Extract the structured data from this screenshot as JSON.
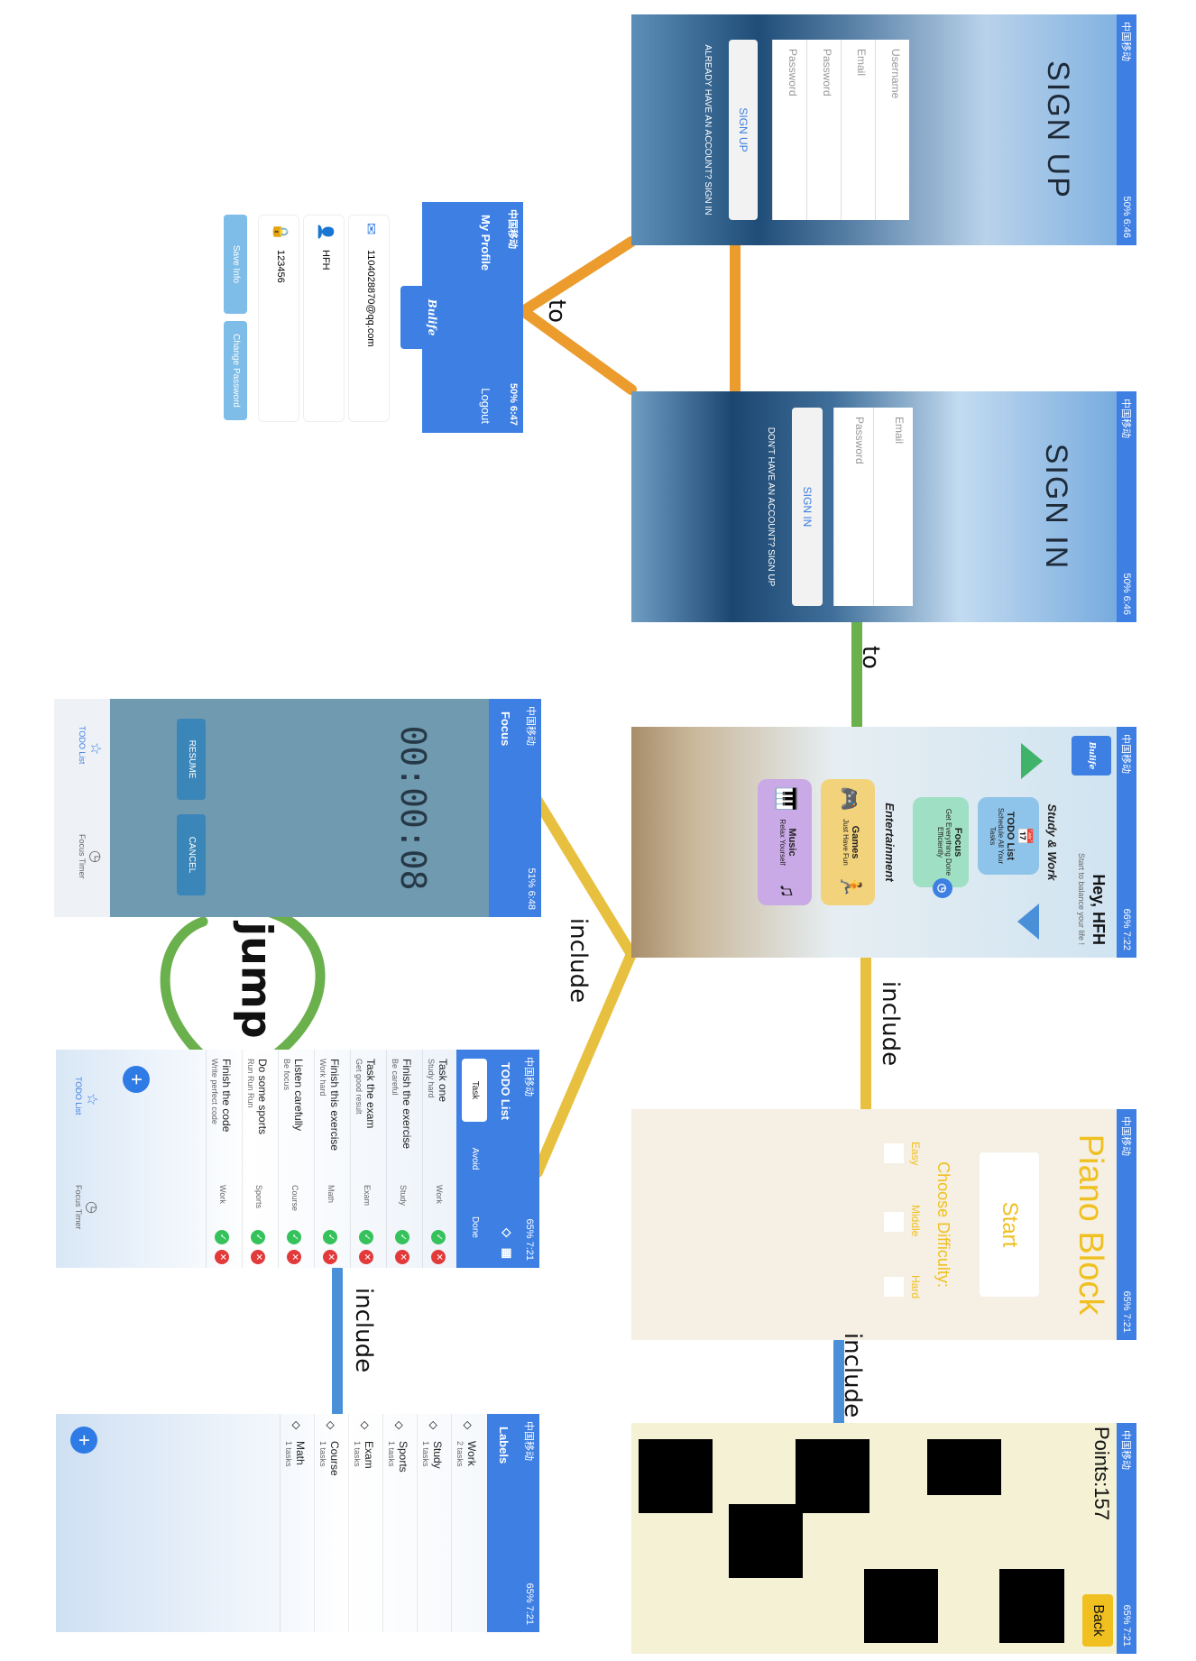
{
  "annotations": {
    "to_1": "to",
    "to_2": "to",
    "include_1": "include",
    "include_2": "include",
    "include_3": "include",
    "include_4": "include",
    "jump": "jump"
  },
  "colors": {
    "orange": "#ec9b2d",
    "green": "#6ab04c",
    "yellow": "#e8c040",
    "blue": "#4a90d9",
    "app_blue": "#3d7fe3"
  },
  "sign_up": {
    "title": "SIGN UP",
    "username": "Username",
    "email": "Email",
    "password": "Password",
    "password2": "Password",
    "button": "SIGN UP",
    "link": "ALREADY HAVE AN ACCOUNT? SIGN IN"
  },
  "sign_in": {
    "title": "SIGN IN",
    "email": "Email",
    "password": "Password",
    "button": "SIGN IN",
    "link": "DON'T HAVE AN ACCOUNT? SIGN UP"
  },
  "profile": {
    "title": "My Profile",
    "logout": "Logout",
    "logo": "Bulife",
    "email": "1104028870@qq.com",
    "name": "HFH",
    "password": "123456",
    "save_button": "Save Info",
    "change_button": "Change Password"
  },
  "home": {
    "greeting": "Hey, HFH",
    "subtitle": "Start to balance your life !",
    "logo": "Bulife",
    "section1": "Study & Work",
    "todo_title": "TODO List",
    "todo_desc": "Schedule All Your Tasks",
    "focus_title": "Focus",
    "focus_desc": "Get Everything Done Efficiently",
    "section2": "Entertainment",
    "games_title": "Games",
    "games_desc": "Just Have Fun",
    "music_title": "Music",
    "music_desc": "Relax Yourself"
  },
  "piano": {
    "title": "Piano Block",
    "start": "Start",
    "choose": "Choose Difficulty:",
    "easy": "Easy",
    "middle": "Middle",
    "hard": "Hard"
  },
  "game": {
    "points": "Points:157",
    "back": "Back"
  },
  "focus": {
    "title": "Focus",
    "timer": "00:00:08",
    "resume": "RESUME",
    "cancel": "CANCEL",
    "nav1": "TODO List",
    "nav2": "Focus Timer"
  },
  "todo": {
    "title": "TODO List",
    "tabs": [
      "Task",
      "Avoid",
      "Done"
    ],
    "tasks": [
      {
        "title": "Task one",
        "sub": "Study hard",
        "tag": "Work"
      },
      {
        "title": "Finish the exercise",
        "sub": "Be careful",
        "tag": "Study"
      },
      {
        "title": "Task the exam",
        "sub": "Get good result",
        "tag": "Exam"
      },
      {
        "title": "Finish this exercise",
        "sub": "Work hard",
        "tag": "Math"
      },
      {
        "title": "Listen carefully",
        "sub": "Be focus",
        "tag": "Course"
      },
      {
        "title": "Do some sports",
        "sub": "Run Run Run",
        "tag": "Sports"
      },
      {
        "title": "Finish the code",
        "sub": "Write perfect code",
        "tag": "Work"
      }
    ],
    "nav1": "TODO List",
    "nav2": "Focus Timer"
  },
  "labels": {
    "title": "Labels",
    "items": [
      {
        "name": "Work",
        "count": "2 tasks"
      },
      {
        "name": "Study",
        "count": "1 tasks"
      },
      {
        "name": "Sports",
        "count": "1 tasks"
      },
      {
        "name": "Exam",
        "count": "1 tasks"
      },
      {
        "name": "Course",
        "count": "1 tasks"
      },
      {
        "name": "Math",
        "count": "1 tasks"
      }
    ]
  }
}
